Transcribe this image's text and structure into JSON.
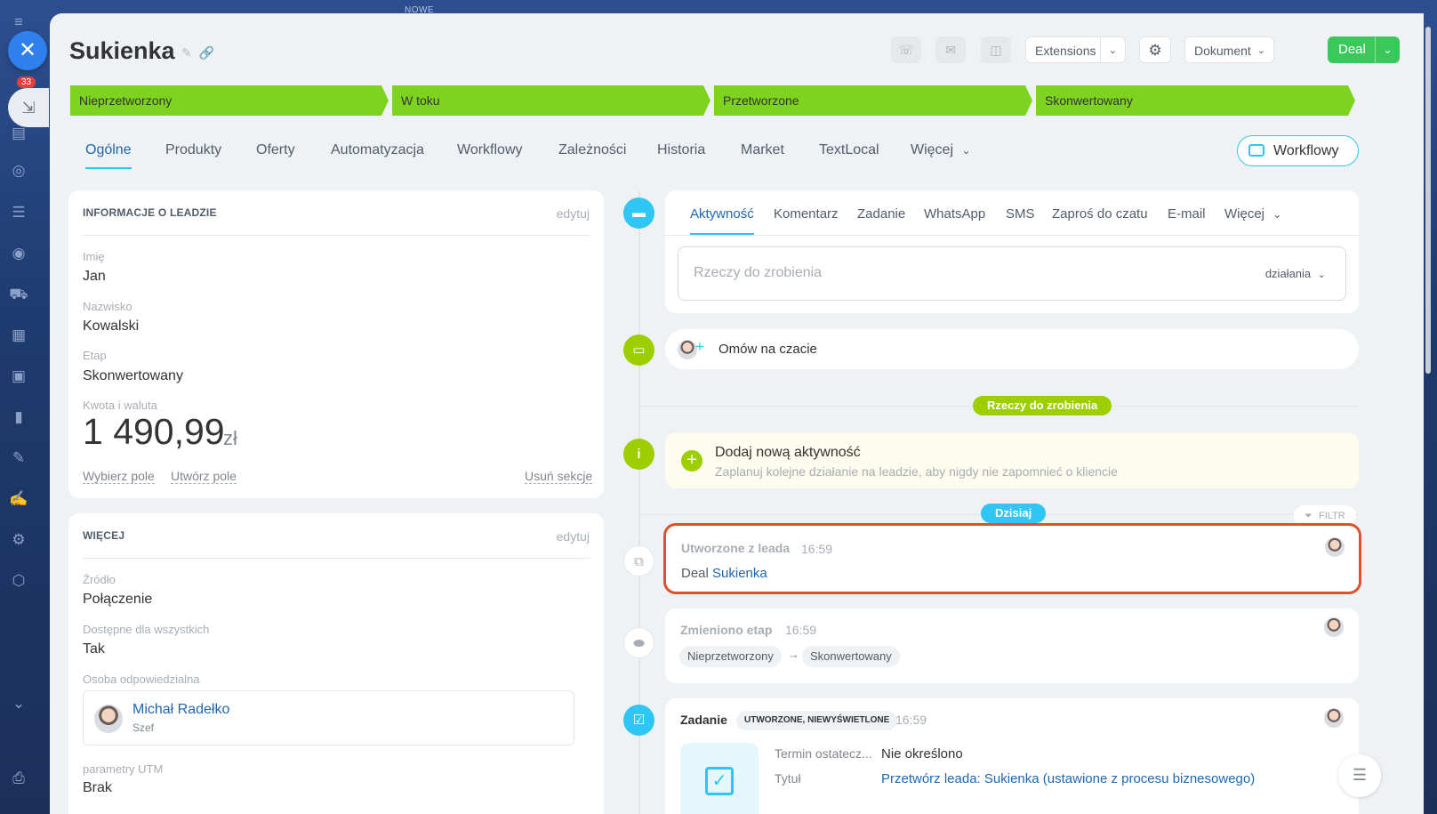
{
  "background": {
    "top_label": "NOWE"
  },
  "sidebar": {
    "badge": "33"
  },
  "header": {
    "title": "Sukienka",
    "extensions_label": "Extensions",
    "document_label": "Dokument",
    "deal_label": "Deal"
  },
  "stages": [
    "Nieprzetworzony",
    "W toku",
    "Przetworzone",
    "Skonwertowany"
  ],
  "tabs": [
    "Ogólne",
    "Produkty",
    "Oferty",
    "Automatyzacja",
    "Workflowy",
    "Zależności",
    "Historia",
    "Market",
    "TextLocal",
    "Więcej"
  ],
  "workflow_button": "Workflowy",
  "lead_info": {
    "title": "INFORMACJE O LEADZIE",
    "edit": "edytuj",
    "fields": [
      {
        "label": "Imię",
        "value": "Jan"
      },
      {
        "label": "Nazwisko",
        "value": "Kowalski"
      },
      {
        "label": "Etap",
        "value": "Skonwertowany"
      }
    ],
    "amount_label": "Kwota i waluta",
    "amount": "1 490,99",
    "currency": "zł",
    "links": {
      "select_field": "Wybierz pole",
      "create_field": "Utwórz pole",
      "delete_section": "Usuń sekcje"
    }
  },
  "more": {
    "title": "WIĘCEJ",
    "edit": "edytuj",
    "fields": [
      {
        "label": "Źródło",
        "value": "Połączenie"
      },
      {
        "label": "Dostępne dla wszystkich",
        "value": "Tak"
      }
    ],
    "responsible_label": "Osoba odpowiedzialna",
    "responsible_name": "Michał Radełko",
    "responsible_role": "Szef",
    "utm_label": "parametry UTM",
    "utm_value": "Brak"
  },
  "activity": {
    "tabs": [
      "Aktywność",
      "Komentarz",
      "Zadanie",
      "WhatsApp",
      "SMS",
      "Zaproś do czatu",
      "E-mail",
      "Więcej"
    ],
    "todo_placeholder": "Rzeczy do zrobienia",
    "todo_actions": "działania",
    "chat_label": "Omów na czacie",
    "todo_pill": "Rzeczy do zrobienia",
    "add_title": "Dodaj nową aktywność",
    "add_sub": "Zaplanuj kolejne działanie na leadzie, aby nigdy nie zapomnieć o kliencie",
    "today_pill": "Dzisiaj",
    "filter": "FILTR"
  },
  "events": {
    "created": {
      "title": "Utworzone z leada",
      "time": "16:59",
      "prefix": "Deal",
      "link": "Sukienka"
    },
    "stage": {
      "title": "Zmieniono etap",
      "time": "16:59",
      "from": "Nieprzetworzony",
      "to": "Skonwertowany"
    },
    "task": {
      "title": "Zadanie",
      "badge": "UTWORZONE, NIEWYŚWIETLONE",
      "time": "16:59",
      "deadline_label": "Termin ostatecz...",
      "deadline_value": "Nie określono",
      "name_label": "Tytuł",
      "name_value": "Przetwórz leada: Sukienka (ustawione z procesu biznesowego)"
    }
  },
  "colors": {
    "accent": "#2fc6f6",
    "stage_green": "#7ed321",
    "deal_green": "#3bc85a",
    "highlight_red": "#e0502a"
  }
}
